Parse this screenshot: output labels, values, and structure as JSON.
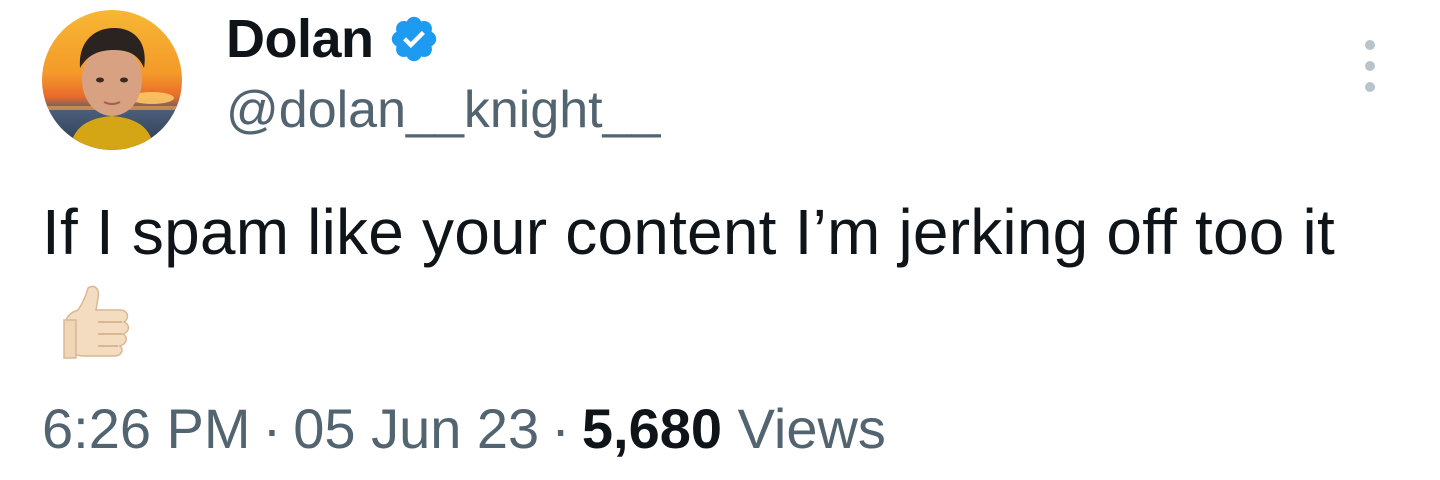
{
  "author": {
    "display_name": "Dolan",
    "handle": "@dolan__knight__",
    "verified": true,
    "verified_color": "#1d9bf0",
    "avatar_icon": "profile-photo"
  },
  "tweet": {
    "text": "If I spam like your content I’m jerking off too it",
    "emoji": "thumbs-up-light-skin-tone"
  },
  "meta": {
    "time": "6:26 PM",
    "separator": "·",
    "date": "05 Jun 23",
    "views_count": "5,680",
    "views_label": "Views"
  },
  "more_icon": "vertical-ellipsis-icon"
}
